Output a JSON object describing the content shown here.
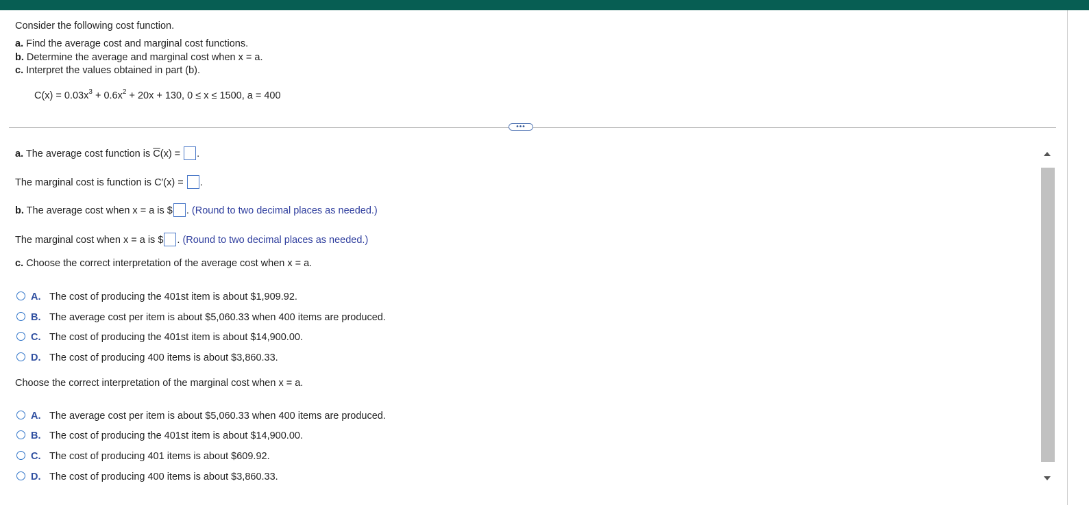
{
  "problem": {
    "intro": "Consider the following cost function.",
    "parts": [
      {
        "label": "a.",
        "text": "Find the average cost and marginal cost functions."
      },
      {
        "label": "b.",
        "text": "Determine the average and marginal cost when x = a."
      },
      {
        "label": "c.",
        "text": "Interpret the values obtained in part (b)."
      }
    ],
    "formula": {
      "p1": "C(x) = 0.03x",
      "e1": "3",
      "p2": " + 0.6x",
      "e2": "2",
      "p3": " + 20x + 130, 0 ≤ x ≤ 1500, a = 400"
    }
  },
  "more_button": "•••",
  "answers": {
    "avg_func": {
      "label": "a.",
      "pre": " The average cost function is ",
      "cbar": "C",
      "post": "(x) = "
    },
    "marg_func": {
      "text": "The marginal cost is function is C′(x) = "
    },
    "avg_value": {
      "label": "b.",
      "pre": " The average cost when x = a is $",
      "hint": "(Round to two decimal places as needed.)"
    },
    "marg_value": {
      "pre": "The marginal cost when x = a is $",
      "hint": "(Round to two decimal places as needed.)"
    },
    "part_c": {
      "label": "c.",
      "text": " Choose the correct interpretation of the average cost when x = a."
    }
  },
  "question1": {
    "options": [
      {
        "letter": "A.",
        "text": "The cost of producing the 401st item is about $1,909.92."
      },
      {
        "letter": "B.",
        "text": "The average cost per item is about $5,060.33 when 400 items are produced."
      },
      {
        "letter": "C.",
        "text": "The cost of producing the 401st item is about $14,900.00."
      },
      {
        "letter": "D.",
        "text": "The cost of producing 400 items is about $3,860.33."
      }
    ]
  },
  "question2": {
    "prompt": "Choose the correct interpretation of the marginal cost when x = a.",
    "options": [
      {
        "letter": "A.",
        "text": "The average cost per item is about $5,060.33 when 400 items are produced."
      },
      {
        "letter": "B.",
        "text": "The cost of producing the 401st item is about $14,900.00."
      },
      {
        "letter": "C.",
        "text": "The cost of producing 401 items is about $609.92."
      },
      {
        "letter": "D.",
        "text": "The cost of producing 400 items is about $3,860.33."
      }
    ]
  },
  "colors": {
    "header": "#075e53",
    "accent": "#2f74c9",
    "hint": "#2f3e9e"
  }
}
